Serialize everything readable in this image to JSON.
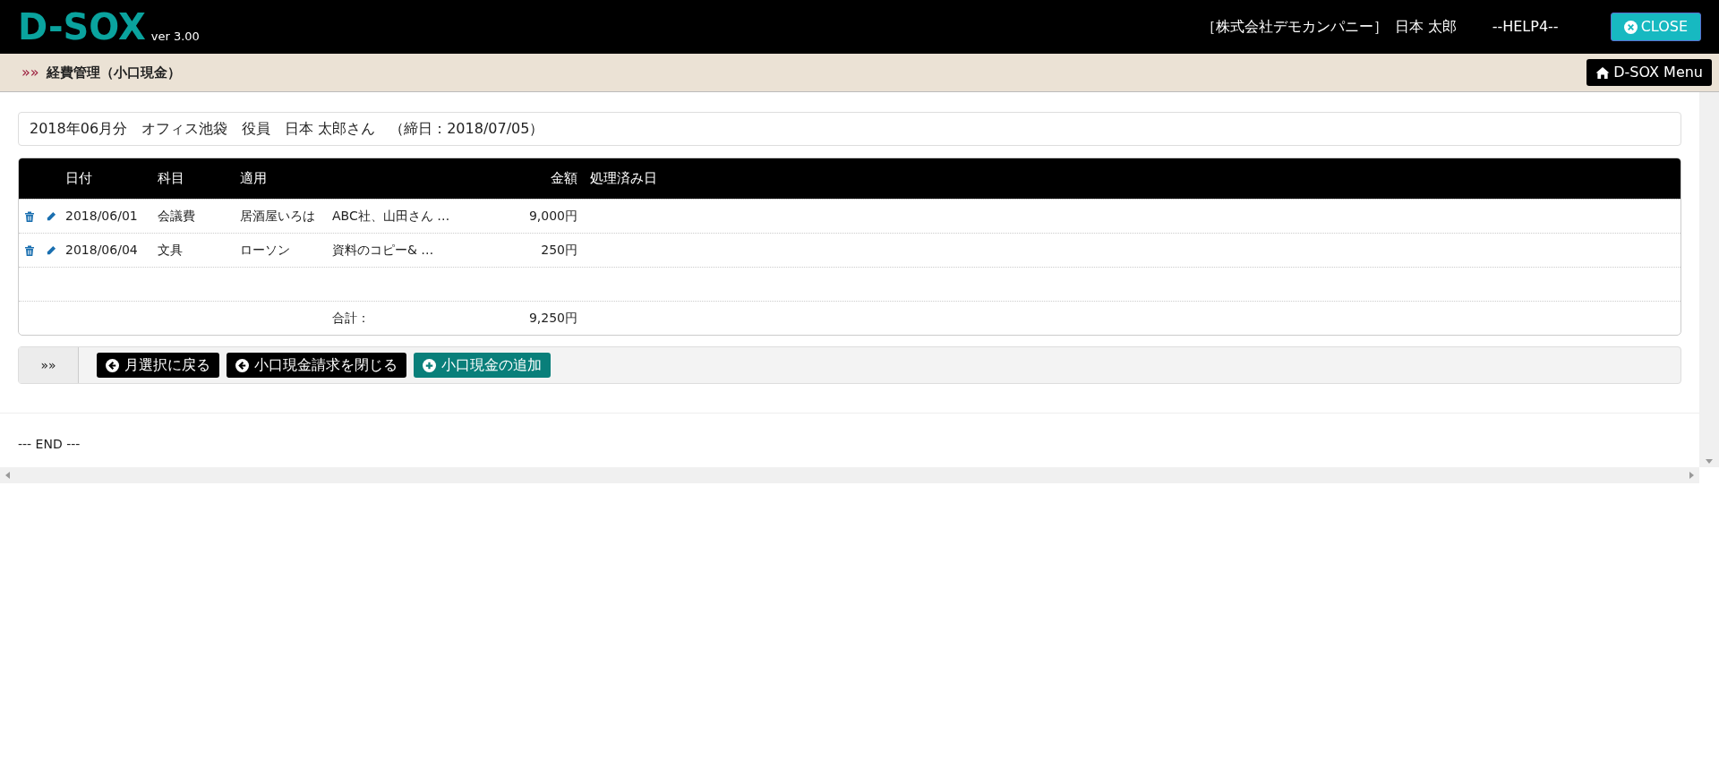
{
  "header": {
    "logo": "D-SOX",
    "version": "ver 3.00",
    "company": "［株式会社デモカンパニー］",
    "user": "日本 太郎",
    "help": "--HELP4--",
    "close_button": "CLOSE"
  },
  "breadcrumb": {
    "marker": "»»",
    "title": "経費管理（小口現金）",
    "menu_button": "D-SOX Menu"
  },
  "summary": "2018年06月分　オフィス池袋　役員　日本 太郎さん　（締日：2018/07/05）",
  "table": {
    "columns": [
      "日付",
      "科目",
      "適用",
      "",
      "金額",
      "処理済み日"
    ],
    "rows": [
      {
        "kind": "entry",
        "cells": [
          "2018/06/01",
          "会議費",
          "居酒屋いろは",
          "ABC社、山田さん …",
          "9,000円",
          ""
        ]
      },
      {
        "kind": "entry",
        "cells": [
          "2018/06/04",
          "文具",
          "ローソン",
          "資料のコピー& …",
          "250円",
          ""
        ]
      },
      {
        "kind": "empty",
        "cells": [
          "",
          "",
          "",
          "",
          "",
          ""
        ]
      },
      {
        "kind": "total",
        "cells": [
          "",
          "",
          "",
          "合計：",
          "9,250円",
          ""
        ]
      }
    ]
  },
  "toolbar": {
    "marker": "»»",
    "buttons": [
      {
        "label": "月選択に戻る",
        "kind": "back"
      },
      {
        "label": "小口現金請求を閉じる",
        "kind": "back"
      },
      {
        "label": "小口現金の追加",
        "kind": "add"
      }
    ]
  },
  "footer": "--- END ---"
}
